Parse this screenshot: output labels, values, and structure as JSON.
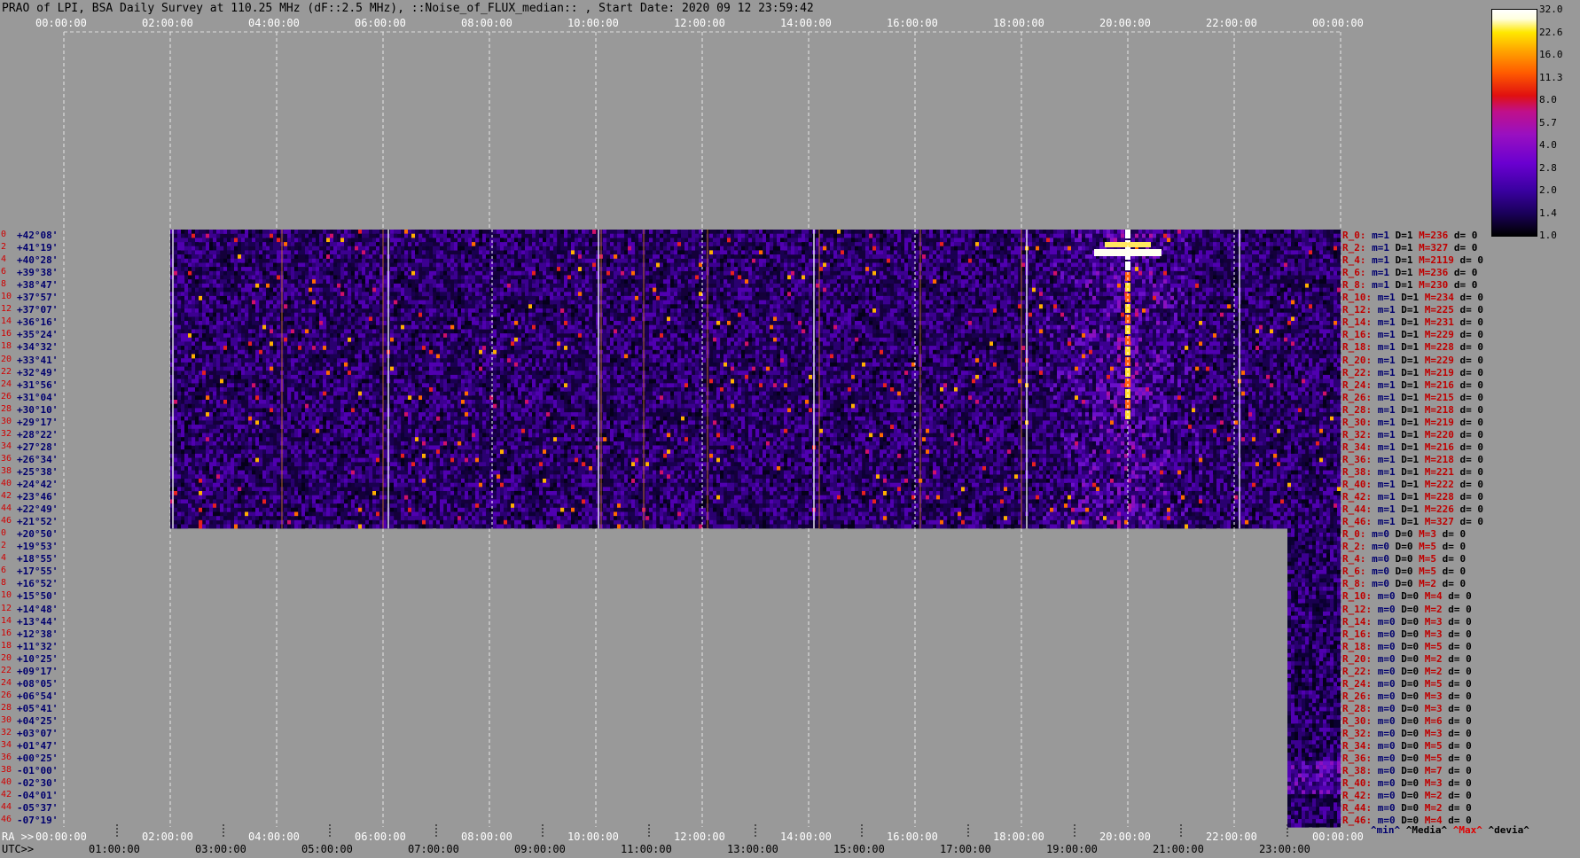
{
  "title": "PRAO of LPI, BSA Daily Survey at 110.25 MHz (dF::2.5 MHz), ::Noise_of_FLUX_median:: , Start Date: 2020 09 12 23:59:42",
  "top_ticks": [
    "00:00:00",
    "02:00:00",
    "04:00:00",
    "06:00:00",
    "08:00:00",
    "10:00:00",
    "12:00:00",
    "14:00:00",
    "16:00:00",
    "18:00:00",
    "20:00:00",
    "22:00:00",
    "00:00:00"
  ],
  "bottom_ra_prefix": "RA >>",
  "bottom_ticks": [
    "00:00:00",
    "02:00:00",
    "04:00:00",
    "06:00:00",
    "08:00:00",
    "10:00:00",
    "12:00:00",
    "14:00:00",
    "16:00:00",
    "18:00:00",
    "20:00:00",
    "22:00:00",
    "00:00:00"
  ],
  "utc_prefix": "UTC>>",
  "utc_ticks": [
    "01:00:00",
    "03:00:00",
    "05:00:00",
    "07:00:00",
    "09:00:00",
    "11:00:00",
    "13:00:00",
    "15:00:00",
    "17:00:00",
    "19:00:00",
    "21:00:00",
    "23:00:00"
  ],
  "row_indices": [
    "0",
    "2",
    "4",
    "6",
    "8",
    "10",
    "12",
    "14",
    "16",
    "18",
    "20",
    "22",
    "24",
    "26",
    "28",
    "30",
    "32",
    "34",
    "36",
    "38",
    "40",
    "42",
    "44",
    "46",
    "0",
    "2",
    "4",
    "6",
    "8",
    "10",
    "12",
    "14",
    "16",
    "18",
    "20",
    "22",
    "24",
    "26",
    "28",
    "30",
    "32",
    "34",
    "36",
    "38",
    "40",
    "42",
    "44",
    "46"
  ],
  "declinations": [
    "+42°08'",
    "+41°19'",
    "+40°28'",
    "+39°38'",
    "+38°47'",
    "+37°57'",
    "+37°07'",
    "+36°16'",
    "+35°24'",
    "+34°32'",
    "+33°41'",
    "+32°49'",
    "+31°56'",
    "+31°04'",
    "+30°10'",
    "+29°17'",
    "+28°22'",
    "+27°28'",
    "+26°34'",
    "+25°38'",
    "+24°42'",
    "+23°46'",
    "+22°49'",
    "+21°52'",
    "+20°50'",
    "+19°53'",
    "+18°55'",
    "+17°55'",
    "+16°52'",
    "+15°50'",
    "+14°48'",
    "+13°44'",
    "+12°38'",
    "+11°32'",
    "+10°25'",
    "+09°17'",
    "+08°05'",
    "+06°54'",
    "+05°41'",
    "+04°25'",
    "+03°07'",
    "+01°47'",
    "+00°25'",
    "-01°00'",
    "-02°30'",
    "-04°01'",
    "-05°37'",
    "-07°19'"
  ],
  "stats": [
    {
      "r": "R_0:",
      "m": "m=1",
      "D": "D=1",
      "M": "M=236",
      "d": "d= 0"
    },
    {
      "r": "R_2:",
      "m": "m=1",
      "D": "D=1",
      "M": "M=327",
      "d": "d= 0"
    },
    {
      "r": "R_4:",
      "m": "m=1",
      "D": "D=1",
      "M": "M=2119",
      "d": "d= 0"
    },
    {
      "r": "R_6:",
      "m": "m=1",
      "D": "D=1",
      "M": "M=236",
      "d": "d= 0"
    },
    {
      "r": "R_8:",
      "m": "m=1",
      "D": "D=1",
      "M": "M=230",
      "d": "d= 0"
    },
    {
      "r": "R_10:",
      "m": "m=1",
      "D": "D=1",
      "M": "M=234",
      "d": "d= 0"
    },
    {
      "r": "R_12:",
      "m": "m=1",
      "D": "D=1",
      "M": "M=225",
      "d": "d= 0"
    },
    {
      "r": "R_14:",
      "m": "m=1",
      "D": "D=1",
      "M": "M=231",
      "d": "d= 0"
    },
    {
      "r": "R_16:",
      "m": "m=1",
      "D": "D=1",
      "M": "M=229",
      "d": "d= 0"
    },
    {
      "r": "R_18:",
      "m": "m=1",
      "D": "D=1",
      "M": "M=228",
      "d": "d= 0"
    },
    {
      "r": "R_20:",
      "m": "m=1",
      "D": "D=1",
      "M": "M=229",
      "d": "d= 0"
    },
    {
      "r": "R_22:",
      "m": "m=1",
      "D": "D=1",
      "M": "M=219",
      "d": "d= 0"
    },
    {
      "r": "R_24:",
      "m": "m=1",
      "D": "D=1",
      "M": "M=216",
      "d": "d= 0"
    },
    {
      "r": "R_26:",
      "m": "m=1",
      "D": "D=1",
      "M": "M=215",
      "d": "d= 0"
    },
    {
      "r": "R_28:",
      "m": "m=1",
      "D": "D=1",
      "M": "M=218",
      "d": "d= 0"
    },
    {
      "r": "R_30:",
      "m": "m=1",
      "D": "D=1",
      "M": "M=219",
      "d": "d= 0"
    },
    {
      "r": "R_32:",
      "m": "m=1",
      "D": "D=1",
      "M": "M=220",
      "d": "d= 0"
    },
    {
      "r": "R_34:",
      "m": "m=1",
      "D": "D=1",
      "M": "M=216",
      "d": "d= 0"
    },
    {
      "r": "R_36:",
      "m": "m=1",
      "D": "D=1",
      "M": "M=218",
      "d": "d= 0"
    },
    {
      "r": "R_38:",
      "m": "m=1",
      "D": "D=1",
      "M": "M=221",
      "d": "d= 0"
    },
    {
      "r": "R_40:",
      "m": "m=1",
      "D": "D=1",
      "M": "M=222",
      "d": "d= 0"
    },
    {
      "r": "R_42:",
      "m": "m=1",
      "D": "D=1",
      "M": "M=228",
      "d": "d= 0"
    },
    {
      "r": "R_44:",
      "m": "m=1",
      "D": "D=1",
      "M": "M=226",
      "d": "d= 0"
    },
    {
      "r": "R_46:",
      "m": "m=1",
      "D": "D=1",
      "M": "M=327",
      "d": "d= 0"
    },
    {
      "r": "R_0:",
      "m": "m=0",
      "D": "D=0",
      "M": "M=3",
      "d": "d= 0"
    },
    {
      "r": "R_2:",
      "m": "m=0",
      "D": "D=0",
      "M": "M=5",
      "d": "d= 0"
    },
    {
      "r": "R_4:",
      "m": "m=0",
      "D": "D=0",
      "M": "M=5",
      "d": "d= 0"
    },
    {
      "r": "R_6:",
      "m": "m=0",
      "D": "D=0",
      "M": "M=5",
      "d": "d= 0"
    },
    {
      "r": "R_8:",
      "m": "m=0",
      "D": "D=0",
      "M": "M=2",
      "d": "d= 0"
    },
    {
      "r": "R_10:",
      "m": "m=0",
      "D": "D=0",
      "M": "M=4",
      "d": "d= 0"
    },
    {
      "r": "R_12:",
      "m": "m=0",
      "D": "D=0",
      "M": "M=2",
      "d": "d= 0"
    },
    {
      "r": "R_14:",
      "m": "m=0",
      "D": "D=0",
      "M": "M=3",
      "d": "d= 0"
    },
    {
      "r": "R_16:",
      "m": "m=0",
      "D": "D=0",
      "M": "M=3",
      "d": "d= 0"
    },
    {
      "r": "R_18:",
      "m": "m=0",
      "D": "D=0",
      "M": "M=5",
      "d": "d= 0"
    },
    {
      "r": "R_20:",
      "m": "m=0",
      "D": "D=0",
      "M": "M=2",
      "d": "d= 0"
    },
    {
      "r": "R_22:",
      "m": "m=0",
      "D": "D=0",
      "M": "M=2",
      "d": "d= 0"
    },
    {
      "r": "R_24:",
      "m": "m=0",
      "D": "D=0",
      "M": "M=5",
      "d": "d= 0"
    },
    {
      "r": "R_26:",
      "m": "m=0",
      "D": "D=0",
      "M": "M=3",
      "d": "d= 0"
    },
    {
      "r": "R_28:",
      "m": "m=0",
      "D": "D=0",
      "M": "M=3",
      "d": "d= 0"
    },
    {
      "r": "R_30:",
      "m": "m=0",
      "D": "D=0",
      "M": "M=6",
      "d": "d= 0"
    },
    {
      "r": "R_32:",
      "m": "m=0",
      "D": "D=0",
      "M": "M=3",
      "d": "d= 0"
    },
    {
      "r": "R_34:",
      "m": "m=0",
      "D": "D=0",
      "M": "M=5",
      "d": "d= 0"
    },
    {
      "r": "R_36:",
      "m": "m=0",
      "D": "D=0",
      "M": "M=5",
      "d": "d= 0"
    },
    {
      "r": "R_38:",
      "m": "m=0",
      "D": "D=0",
      "M": "M=7",
      "d": "d= 0"
    },
    {
      "r": "R_40:",
      "m": "m=0",
      "D": "D=0",
      "M": "M=3",
      "d": "d= 0"
    },
    {
      "r": "R_42:",
      "m": "m=0",
      "D": "D=0",
      "M": "M=2",
      "d": "d= 0"
    },
    {
      "r": "R_44:",
      "m": "m=0",
      "D": "D=0",
      "M": "M=2",
      "d": "d= 0"
    },
    {
      "r": "R_46:",
      "m": "m=0",
      "D": "D=0",
      "M": "M=4",
      "d": "d= 0"
    }
  ],
  "stats_legend": {
    "min": "^min^",
    "media": "^Media^",
    "max": "^Max^",
    "devia": "^devia^"
  },
  "colors": {
    "background": "#999999",
    "dec_label": "#00006e",
    "row_index": "#d00000",
    "max_label": "#c00000"
  },
  "chart_data": {
    "type": "heatmap",
    "title": "PRAO of LPI, BSA Daily Survey at 110.25 MHz (dF::2.5 MHz), ::Noise_of_FLUX_median:: , Start Date: 2020 09 12 23:59:42",
    "x_axis": "RA (hours)",
    "x_ticks": [
      "00:00:00",
      "02:00:00",
      "04:00:00",
      "06:00:00",
      "08:00:00",
      "10:00:00",
      "12:00:00",
      "14:00:00",
      "16:00:00",
      "18:00:00",
      "20:00:00",
      "22:00:00",
      "00:00:00"
    ],
    "xlim_hours": [
      0,
      24
    ],
    "colorbar_ticks": [
      "32.0",
      "22.6",
      "16.0",
      "11.3",
      "8.0",
      "5.7",
      "4.0",
      "2.8",
      "2.0",
      "1.4",
      "1.0"
    ],
    "colorbar_range": [
      1.0,
      32.0
    ],
    "colorbar_scale": "log",
    "colormap": "gnuplot (black-blue-purple-red-orange-yellow-white)",
    "data_regions": [
      {
        "declination_from": "+42°08'",
        "declination_to": "+21°52'",
        "ra_from_hours": 2.0,
        "ra_to_hours": 24.0
      },
      {
        "declination_from": "+20°50'",
        "declination_to": "-07°19'",
        "ra_from_hours": 23.0,
        "ra_to_hours": 24.0
      }
    ],
    "bright_source": {
      "ra_hours": 20.0,
      "declination": "+40°28'",
      "row": "R_4",
      "max": 2119
    },
    "grid": true
  }
}
